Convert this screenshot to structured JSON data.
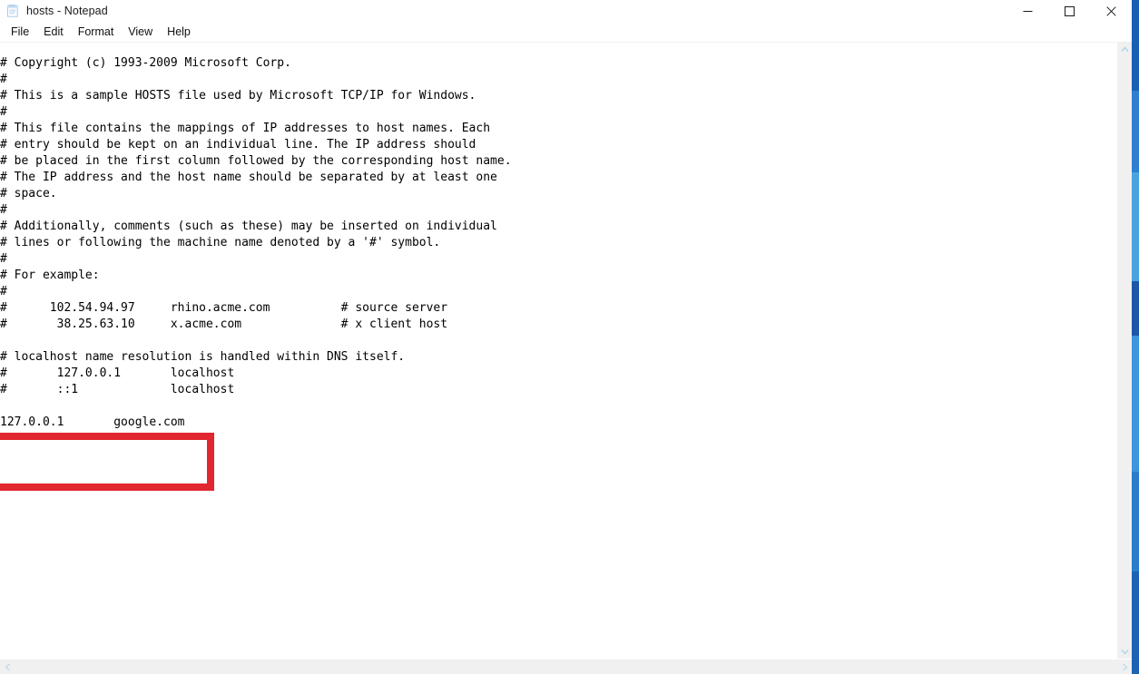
{
  "window": {
    "title": "hosts - Notepad",
    "app_icon": "notepad-icon"
  },
  "titlebar": {
    "minimize_label": "Minimize",
    "maximize_label": "Maximize",
    "close_label": "Close"
  },
  "menubar": {
    "items": [
      {
        "label": "File"
      },
      {
        "label": "Edit"
      },
      {
        "label": "Format"
      },
      {
        "label": "View"
      },
      {
        "label": "Help"
      }
    ]
  },
  "editor": {
    "filename": "hosts",
    "font": "monospace",
    "text": "# Copyright (c) 1993-2009 Microsoft Corp.\n#\n# This is a sample HOSTS file used by Microsoft TCP/IP for Windows.\n#\n# This file contains the mappings of IP addresses to host names. Each\n# entry should be kept on an individual line. The IP address should\n# be placed in the first column followed by the corresponding host name.\n# The IP address and the host name should be separated by at least one\n# space.\n#\n# Additionally, comments (such as these) may be inserted on individual\n# lines or following the machine name denoted by a '#' symbol.\n#\n# For example:\n#\n#      102.54.94.97     rhino.acme.com          # source server\n#       38.25.63.10     x.acme.com              # x client host\n\n# localhost name resolution is handled within DNS itself.\n#       127.0.0.1       localhost\n#       ::1             localhost\n\n127.0.0.1       google.com",
    "lines": [
      "# Copyright (c) 1993-2009 Microsoft Corp.",
      "#",
      "# This is a sample HOSTS file used by Microsoft TCP/IP for Windows.",
      "#",
      "# This file contains the mappings of IP addresses to host names. Each",
      "# entry should be kept on an individual line. The IP address should",
      "# be placed in the first column followed by the corresponding host name.",
      "# The IP address and the host name should be separated by at least one",
      "# space.",
      "#",
      "# Additionally, comments (such as these) may be inserted on individual",
      "# lines or following the machine name denoted by a '#' symbol.",
      "#",
      "# For example:",
      "#",
      "#      102.54.94.97     rhino.acme.com          # source server",
      "#       38.25.63.10     x.acme.com              # x client host",
      "",
      "# localhost name resolution is handled within DNS itself.",
      "#       127.0.0.1       localhost",
      "#       ::1             localhost",
      "",
      "127.0.0.1       google.com"
    ],
    "highlighted_entry": {
      "ip": "127.0.0.1",
      "hostname": "google.com",
      "annotation_color": "#e0262f"
    }
  },
  "scrollbars": {
    "vertical": {
      "up_arrow": "chevron-up-icon",
      "down_arrow": "chevron-down-icon"
    },
    "horizontal": {
      "left_arrow": "chevron-left-icon",
      "right_arrow": "chevron-right-icon"
    }
  },
  "colors": {
    "annotation_red": "#e0262f",
    "scrollbar_track": "#f0f0f0",
    "text": "#000000",
    "background": "#ffffff",
    "edge_blue": "#1565c0"
  }
}
